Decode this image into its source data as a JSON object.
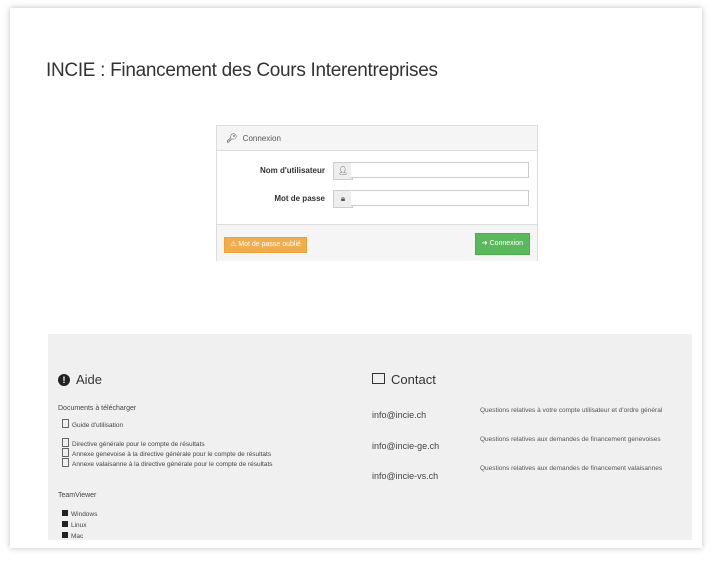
{
  "page": {
    "title": "INCIE : Financement des Cours Interentreprises"
  },
  "login": {
    "heading": "Connexion",
    "username_label": "Nom d'utilisateur",
    "password_label": "Mot de passe",
    "username_value": "",
    "password_value": "",
    "forgot_label": "Mot de passe oublié",
    "submit_label": "Connexion"
  },
  "help": {
    "title": "Aide",
    "download_label": "Documents à télécharger",
    "docs": [
      "Guide d'utilisation",
      "Directive générale pour le compte de résultats",
      "Annexe genevoise à la directive générale pour le compte de résultats",
      "Annexe valaisanne à la directive générale pour le compte de résultats"
    ],
    "teamviewer_label": "TeamViewer",
    "os": [
      "Windows",
      "Linux",
      "Mac"
    ]
  },
  "contact": {
    "title": "Contact",
    "entries": [
      {
        "email": "info@incie.ch",
        "desc": "Questions relatives à votre compte utilisateur et d'ordre général"
      },
      {
        "email": "info@incie-ge.ch",
        "desc": "Questions relatives aux demandes de financement genevoises"
      },
      {
        "email": "info@incie-vs.ch",
        "desc": "Questions relatives aux demandes de financement valaisannes"
      }
    ]
  },
  "icons": {
    "login": "key-icon",
    "username": "user-icon",
    "password": "lock-icon",
    "help": "info-circle-icon",
    "contact": "envelope-icon",
    "forgot": "warning-icon",
    "submit": "sign-in-icon"
  },
  "colors": {
    "warning": "#f0ad4e",
    "success": "#5cb85c",
    "footer_bg": "#f0f0f0"
  }
}
